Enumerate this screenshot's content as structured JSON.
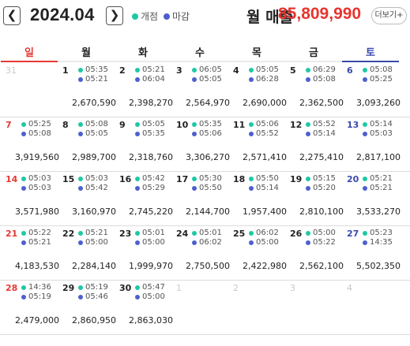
{
  "header": {
    "prev_icon": "chevron-left-icon",
    "prev_glyph": "❮",
    "month": "2024.04",
    "next_icon": "chevron-right-icon",
    "next_glyph": "❯",
    "legend_open": "개점",
    "legend_close": "마감",
    "revenue_label": "월 매출",
    "revenue_value": "85,809,990",
    "more_label": "더보기+"
  },
  "colors": {
    "open": "#1ec8a5",
    "close": "#4d5fcf",
    "sunday": "#e53935",
    "saturday": "#3949ab",
    "revenue": "#e8342e"
  },
  "weekdays": [
    "일",
    "월",
    "화",
    "수",
    "목",
    "금",
    "토"
  ],
  "weeks": [
    [
      {
        "day": "31",
        "empty": true
      },
      {
        "day": "1",
        "open": "05:35",
        "close": "05:21",
        "sales": "2,670,590"
      },
      {
        "day": "2",
        "open": "05:21",
        "close": "06:04",
        "sales": "2,398,270"
      },
      {
        "day": "3",
        "open": "06:05",
        "close": "05:05",
        "sales": "2,564,970"
      },
      {
        "day": "4",
        "open": "05:05",
        "close": "06:28",
        "sales": "2,690,000"
      },
      {
        "day": "5",
        "open": "06:29",
        "close": "05:08",
        "sales": "2,362,500"
      },
      {
        "day": "6",
        "open": "05:08",
        "close": "05:25",
        "sales": "3,093,260"
      }
    ],
    [
      {
        "day": "7",
        "open": "05:25",
        "close": "05:08",
        "sales": "3,919,560"
      },
      {
        "day": "8",
        "open": "05:08",
        "close": "05:05",
        "sales": "2,989,700"
      },
      {
        "day": "9",
        "open": "05:05",
        "close": "05:35",
        "sales": "2,318,760"
      },
      {
        "day": "10",
        "open": "05:35",
        "close": "05:06",
        "sales": "3,306,270"
      },
      {
        "day": "11",
        "open": "05:06",
        "close": "05:52",
        "sales": "2,571,410"
      },
      {
        "day": "12",
        "open": "05:52",
        "close": "05:14",
        "sales": "2,275,410"
      },
      {
        "day": "13",
        "open": "05:14",
        "close": "05:03",
        "sales": "2,817,100"
      }
    ],
    [
      {
        "day": "14",
        "open": "05:03",
        "close": "05:03",
        "sales": "3,571,980"
      },
      {
        "day": "15",
        "open": "05:03",
        "close": "05:42",
        "sales": "3,160,970"
      },
      {
        "day": "16",
        "open": "05:42",
        "close": "05:29",
        "sales": "2,745,220"
      },
      {
        "day": "17",
        "open": "05:30",
        "close": "05:50",
        "sales": "2,144,700"
      },
      {
        "day": "18",
        "open": "05:50",
        "close": "05:14",
        "sales": "1,957,400"
      },
      {
        "day": "19",
        "open": "05:15",
        "close": "05:20",
        "sales": "2,810,100"
      },
      {
        "day": "20",
        "open": "05:21",
        "close": "05:21",
        "sales": "3,533,270"
      }
    ],
    [
      {
        "day": "21",
        "open": "05:22",
        "close": "05:21",
        "sales": "4,183,530"
      },
      {
        "day": "22",
        "open": "05:21",
        "close": "05:00",
        "sales": "2,284,140"
      },
      {
        "day": "23",
        "open": "05:01",
        "close": "05:00",
        "sales": "1,999,970"
      },
      {
        "day": "24",
        "open": "05:01",
        "close": "06:02",
        "sales": "2,750,500"
      },
      {
        "day": "25",
        "open": "06:02",
        "close": "05:00",
        "sales": "2,422,980"
      },
      {
        "day": "26",
        "open": "05:00",
        "close": "05:22",
        "sales": "2,562,100"
      },
      {
        "day": "27",
        "open": "05:23",
        "close": "14:35",
        "sales": "5,502,350"
      }
    ],
    [
      {
        "day": "28",
        "open": "14:36",
        "close": "05:19",
        "sales": "2,479,000"
      },
      {
        "day": "29",
        "open": "05:19",
        "close": "05:46",
        "sales": "2,860,950"
      },
      {
        "day": "30",
        "open": "05:47",
        "close": "05:00",
        "sales": "2,863,030"
      },
      {
        "day": "1",
        "empty": true
      },
      {
        "day": "2",
        "empty": true
      },
      {
        "day": "3",
        "empty": true
      },
      {
        "day": "4",
        "empty": true
      }
    ]
  ]
}
